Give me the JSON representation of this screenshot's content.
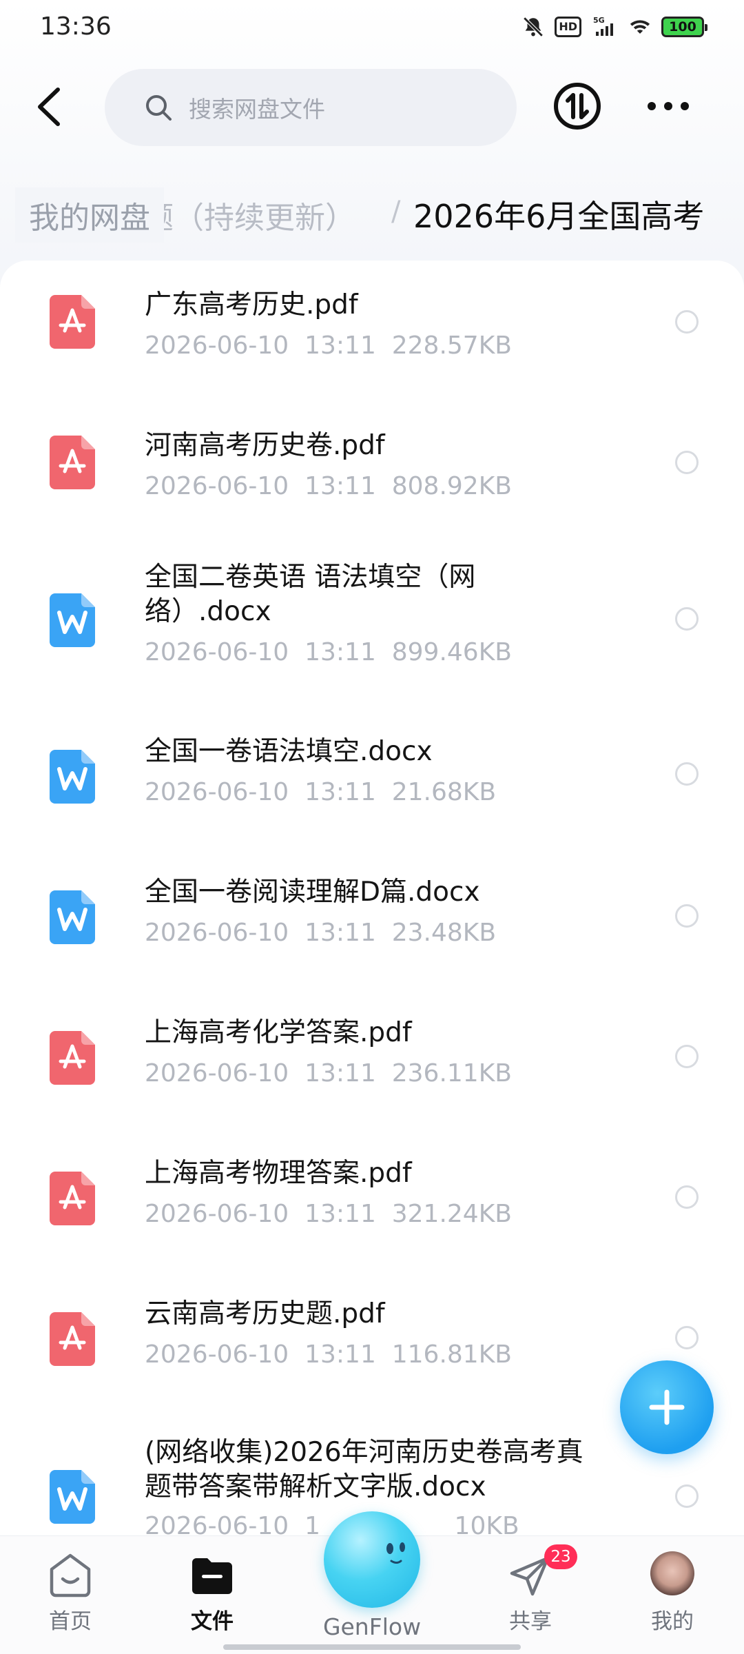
{
  "status_bar": {
    "time": "13:36",
    "network": "5G",
    "hd": "HD",
    "battery": "100"
  },
  "header": {
    "search_placeholder": "搜索网盘文件"
  },
  "breadcrumb": {
    "root": "我的网盘",
    "middle": "题（持续更新）",
    "separator": "/",
    "current": "2026年6月全国高考"
  },
  "files": [
    {
      "type": "pdf",
      "name": "广东高考历史.pdf",
      "date": "2026-06-10",
      "time": "13:11",
      "size": "228.57KB"
    },
    {
      "type": "pdf",
      "name": "河南高考历史卷.pdf",
      "date": "2026-06-10",
      "time": "13:11",
      "size": "808.92KB"
    },
    {
      "type": "docx",
      "name_line1": "全国二卷英语 语法填空（网",
      "name_line2": "络）.docx",
      "date": "2026-06-10",
      "time": "13:11",
      "size": "899.46KB"
    },
    {
      "type": "docx",
      "name": "全国一卷语法填空.docx",
      "date": "2026-06-10",
      "time": "13:11",
      "size": "21.68KB"
    },
    {
      "type": "docx",
      "name": "全国一卷阅读理解D篇.docx",
      "date": "2026-06-10",
      "time": "13:11",
      "size": "23.48KB"
    },
    {
      "type": "pdf",
      "name": "上海高考化学答案.pdf",
      "date": "2026-06-10",
      "time": "13:11",
      "size": "236.11KB"
    },
    {
      "type": "pdf",
      "name": "上海高考物理答案.pdf",
      "date": "2026-06-10",
      "time": "13:11",
      "size": "321.24KB"
    },
    {
      "type": "pdf",
      "name": "云南高考历史题.pdf",
      "date": "2026-06-10",
      "time": "13:11",
      "size": "116.81KB"
    },
    {
      "type": "docx",
      "name_line1": "(网络收集)2026年河南历史卷高考真",
      "name_line2": "题带答案带解析文字版.docx",
      "date": "2026-06-10",
      "time": "1",
      "size": "10KB"
    }
  ],
  "file_meta": [
    "2026-06-10  13:11  228.57KB",
    "2026-06-10  13:11  808.92KB",
    "2026-06-10  13:11  899.46KB",
    "2026-06-10  13:11  21.68KB",
    "2026-06-10  13:11  23.48KB",
    "2026-06-10  13:11  236.11KB",
    "2026-06-10  13:11  321.24KB",
    "2026-06-10  13:11  116.81KB",
    "2026-06-10  1                 10KB"
  ],
  "bottom_nav": {
    "home": "首页",
    "files": "文件",
    "genflow": "GenFlow",
    "share": "共享",
    "share_badge": "23",
    "mine": "我的"
  },
  "colors": {
    "pdf": "#f0666e",
    "docx": "#3aa4f5",
    "fab": "#1e9ff0",
    "badge": "#ff2e57"
  }
}
